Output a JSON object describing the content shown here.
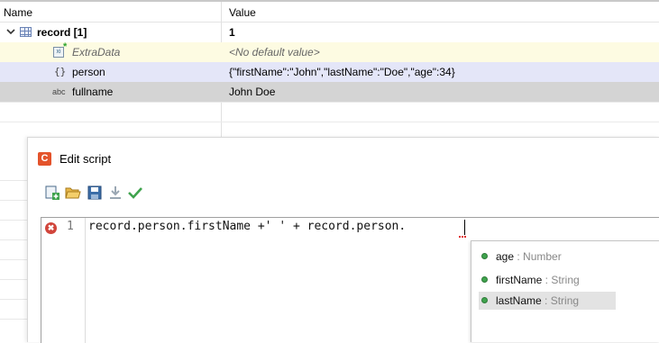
{
  "table": {
    "header": {
      "name": "Name",
      "value": "Value"
    },
    "rows": [
      {
        "name": "record [1]",
        "value": "1",
        "icon": "table-icon"
      },
      {
        "name": "ExtraData",
        "value": "<No default value>",
        "icon": "extra-data-icon"
      },
      {
        "name": "person",
        "value": "{\"firstName\":\"John\",\"lastName\":\"Doe\",\"age\":34}",
        "icon": "braces-icon",
        "icon_text": "{}"
      },
      {
        "name": "fullname",
        "value": "John Doe",
        "icon": "string-type-icon",
        "icon_text": "abc"
      }
    ]
  },
  "dialog": {
    "app_icon_letter": "C",
    "title": "Edit script",
    "toolbar": [
      "new-script-icon",
      "open-folder-icon",
      "save-icon",
      "download-icon",
      "check-icon"
    ]
  },
  "editor": {
    "error_icon": "✖",
    "line_number": "1",
    "code": "record.person.firstName +' ' + record.person."
  },
  "completion": {
    "items": [
      {
        "name": "age",
        "type": " : Number"
      },
      {
        "name": "firstName",
        "type": " : String"
      },
      {
        "name": "lastName",
        "type": " : String",
        "selected": true
      }
    ]
  },
  "colors": {
    "extra_row": "#fdfbe2",
    "person_row": "#e4e6f8",
    "fullname_row": "#d4d4d4",
    "app_icon": "#e4532b",
    "error": "#d1453b",
    "member_dot": "#3fa34d"
  }
}
